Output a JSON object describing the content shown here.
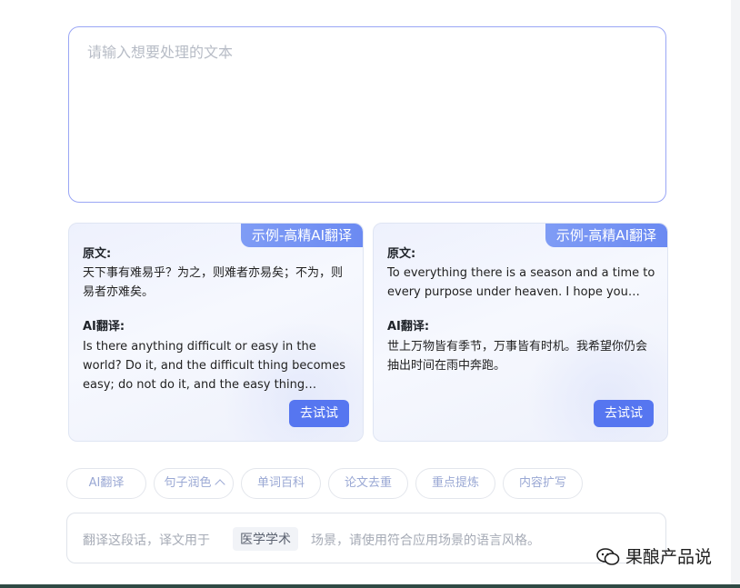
{
  "input": {
    "placeholder": "请输入想要处理的文本"
  },
  "cards": [
    {
      "tag": "示例-高精AI翻译",
      "source_label": "原文:",
      "source_text": "天下事有难易乎？为之，则难者亦易矣；不为，则易者亦难矣。",
      "result_label": "AI翻译:",
      "result_text": "Is there anything difficult or easy in the world? Do it, and the difficult thing becomes easy; do not do it, and the easy thing…",
      "button": "去试试"
    },
    {
      "tag": "示例-高精AI翻译",
      "source_label": "原文:",
      "source_text": "To everything there is a season and a time to every purpose under heaven. I hope you…",
      "result_label": "AI翻译:",
      "result_text": "世上万物皆有季节，万事皆有时机。我希望你仍会抽出时间在雨中奔跑。",
      "button": "去试试"
    }
  ],
  "chips": [
    "AI翻译",
    "句子润色",
    "单词百科",
    "论文去重",
    "重点提炼",
    "内容扩写"
  ],
  "prompt": {
    "before": "翻译这段话，译文用于",
    "tag": "医学学术",
    "after": "场景，请使用符合应用场景的语言风格。"
  },
  "watermark": "果酿产品说",
  "colors": {
    "accent": "#5676f0",
    "tag": "#7f9cf5",
    "chip_text": "#9aa8d4"
  }
}
